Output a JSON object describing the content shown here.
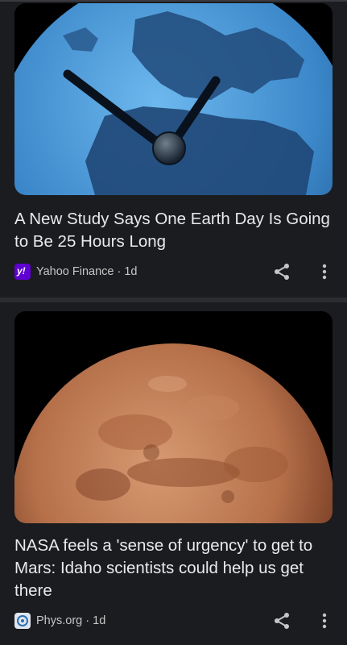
{
  "feed": {
    "articles": [
      {
        "title": "A New Study Says One Earth Day Is Going to Be 25 Hours Long",
        "source": "Yahoo Finance",
        "age": "1d",
        "logo_text": "y!",
        "logo_color": "#5f01d1",
        "image_icon": "earth-clock-image"
      },
      {
        "title": "NASA feels a 'sense of urgency' to get to Mars: Idaho scientists could help us get there",
        "source": "Phys.org",
        "age": "1d",
        "image_icon": "mars-planet-image"
      }
    ],
    "separator": " · ",
    "share_icon": "share-icon",
    "more_icon": "more-vert-icon"
  }
}
